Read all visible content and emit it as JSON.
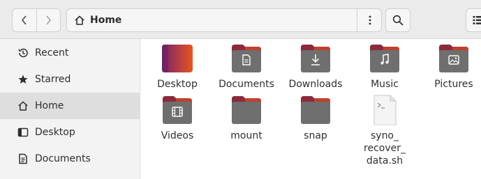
{
  "header": {
    "path_label": "Home"
  },
  "sidebar": {
    "items": [
      {
        "label": "Recent",
        "icon": "clock-icon"
      },
      {
        "label": "Starred",
        "icon": "star-icon"
      },
      {
        "label": "Home",
        "icon": "home-icon",
        "active": true
      },
      {
        "label": "Desktop",
        "icon": "desktop-icon"
      },
      {
        "label": "Documents",
        "icon": "document-icon"
      }
    ]
  },
  "files": [
    {
      "label": "Desktop",
      "type": "folder-desktop"
    },
    {
      "label": "Documents",
      "type": "folder-documents"
    },
    {
      "label": "Downloads",
      "type": "folder-downloads"
    },
    {
      "label": "Music",
      "type": "folder-music"
    },
    {
      "label": "Pictures",
      "type": "folder-pictures"
    },
    {
      "label": "Videos",
      "type": "folder-videos"
    },
    {
      "label": "mount",
      "type": "folder"
    },
    {
      "label": "snap",
      "type": "folder"
    },
    {
      "label": "syno_\nrecover_\ndata.sh",
      "type": "script-file"
    }
  ],
  "colors": {
    "folder_body": "#6f6f6f",
    "folder_tab": "#8c2a3d",
    "folder_tab_accent": "#e95420",
    "desktop_gradient_start": "#77216f",
    "desktop_gradient_end": "#e95420",
    "active_row": "#dedede"
  }
}
